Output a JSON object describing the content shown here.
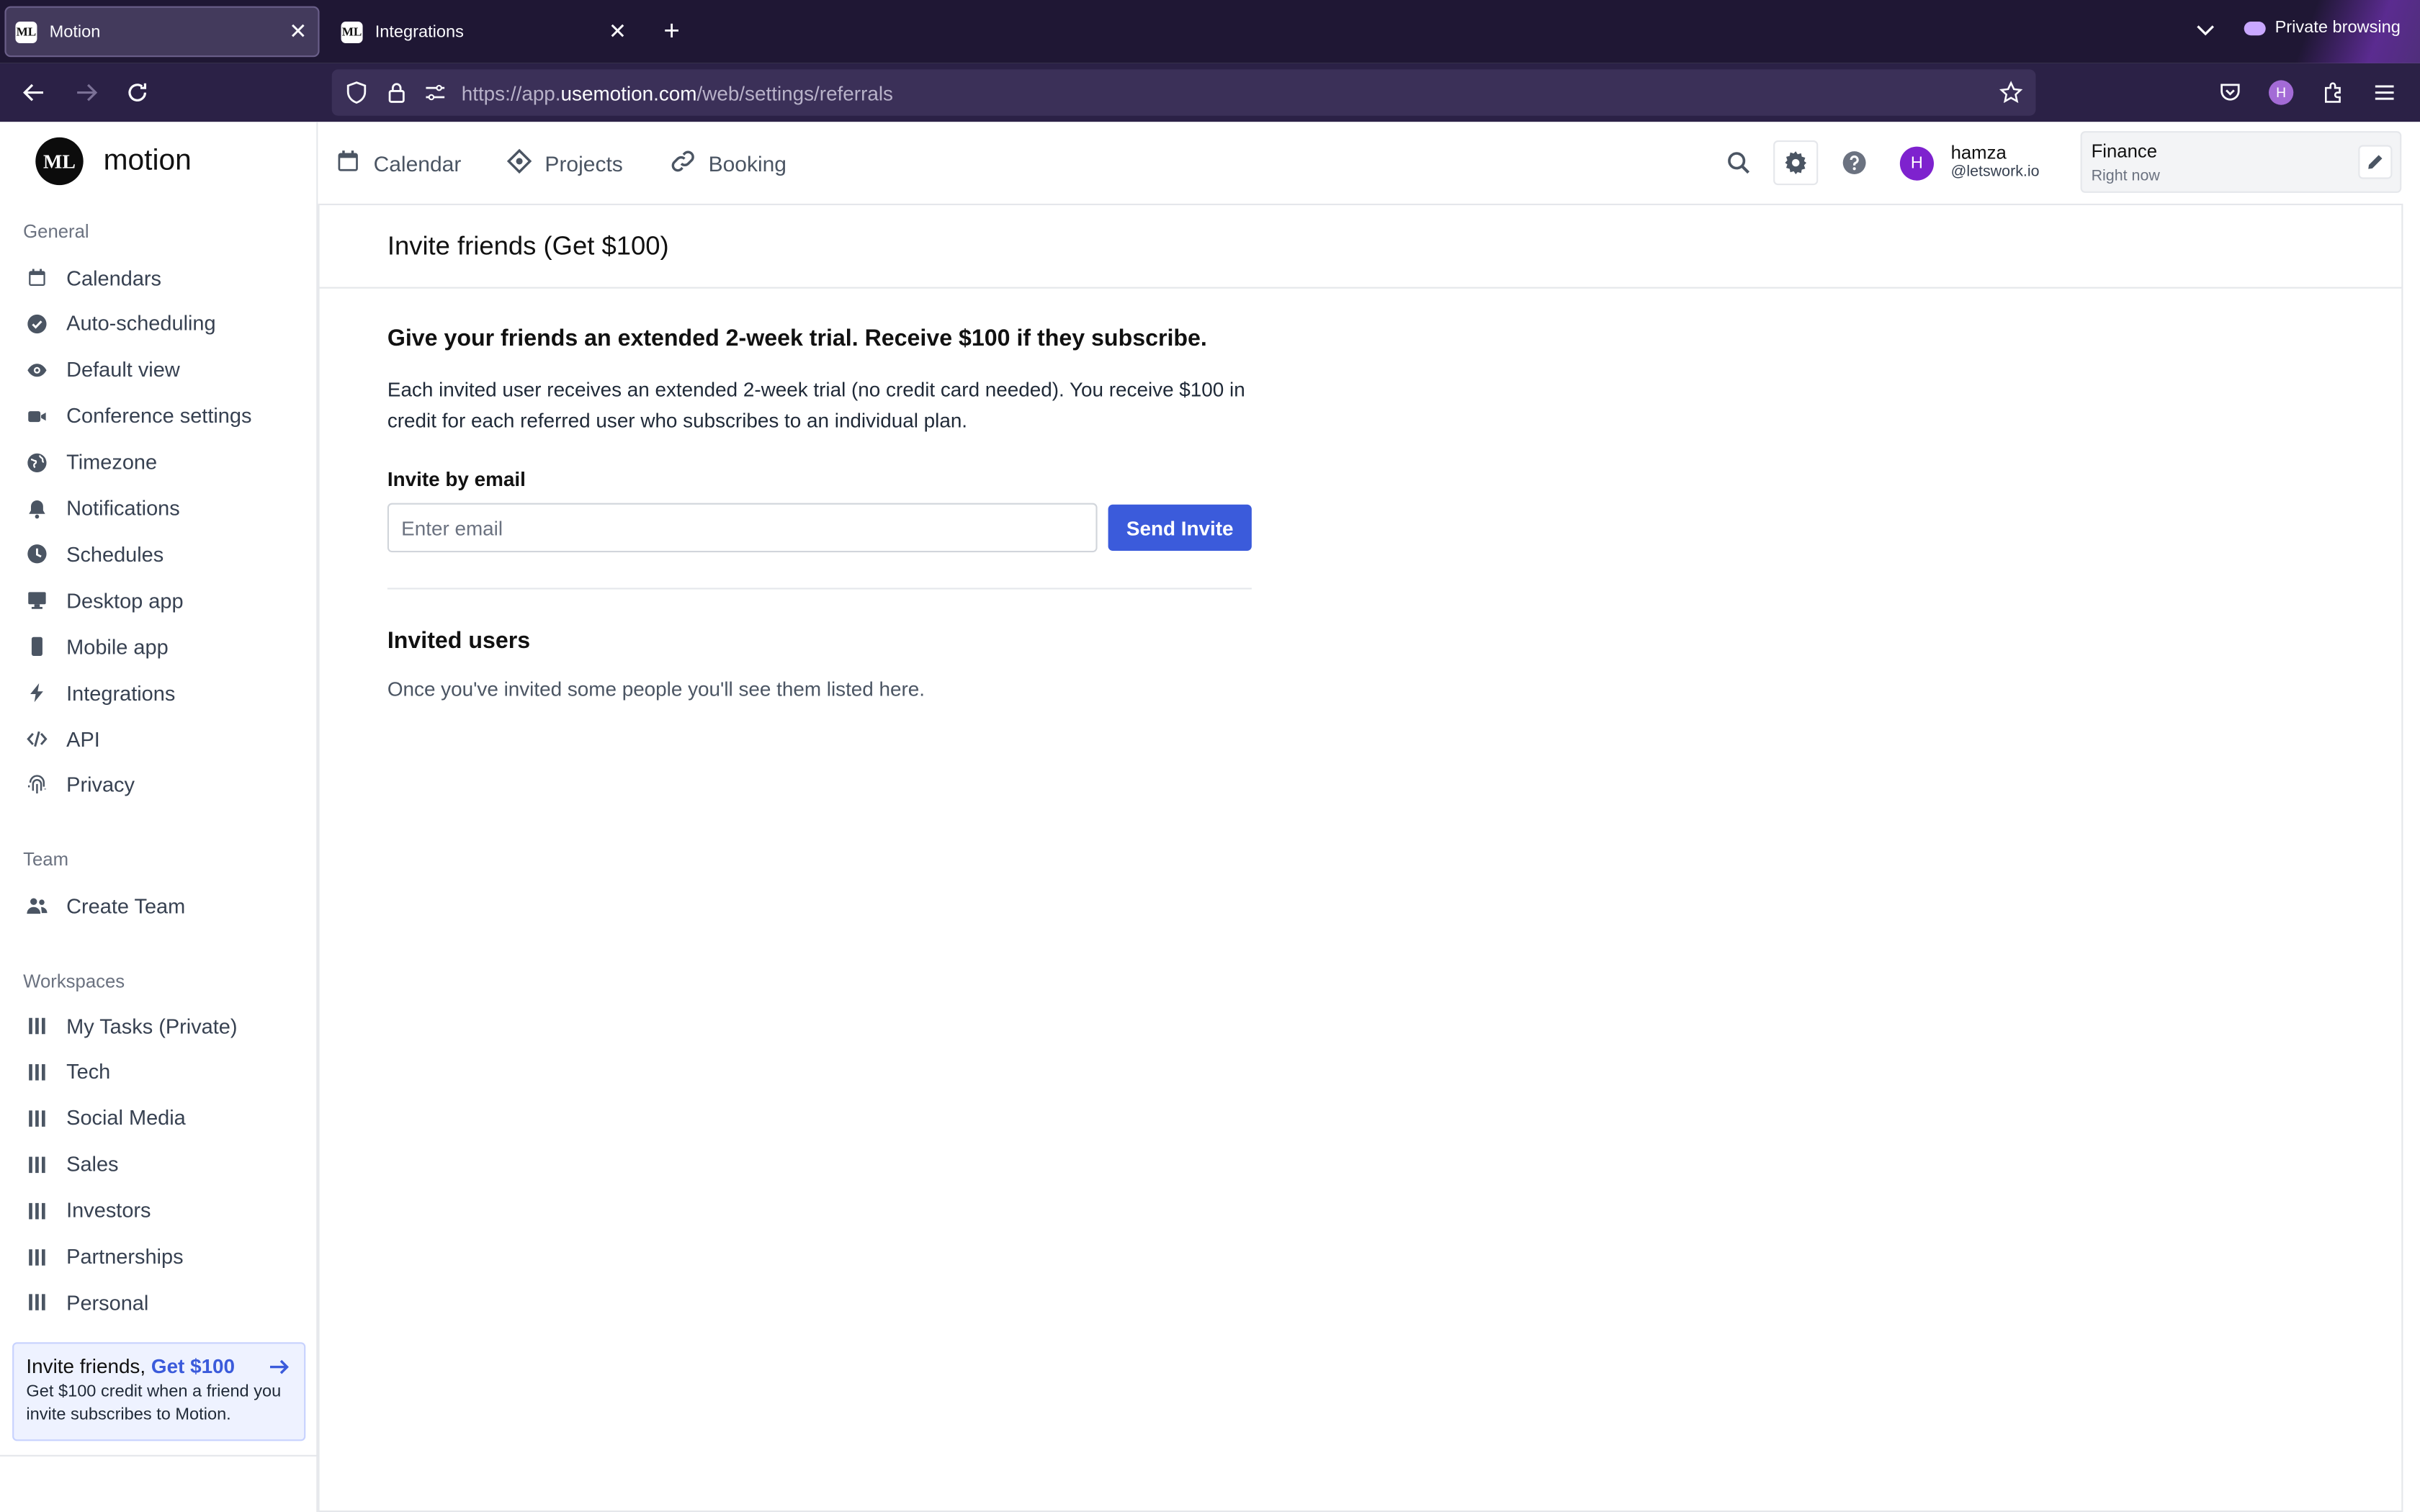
{
  "browser": {
    "tabs": [
      {
        "label": "Motion",
        "active": true
      },
      {
        "label": "Integrations",
        "active": false
      }
    ],
    "favicon_text": "ML",
    "private_label": "Private browsing",
    "url_prefix": "https://app.",
    "url_domain": "usemotion.com",
    "url_path": "/web/settings/referrals",
    "profile_initial": "H"
  },
  "app": {
    "brand": "motion",
    "logo_text": "ML",
    "nav": [
      {
        "label": "Calendar",
        "icon": "calendar-icon"
      },
      {
        "label": "Projects",
        "icon": "diamond-icon"
      },
      {
        "label": "Booking",
        "icon": "link-icon"
      }
    ],
    "user": {
      "initial": "H",
      "name": "hamza",
      "handle": "@letswork.io"
    },
    "current_task": {
      "title": "Finance",
      "subtitle": "Right now"
    }
  },
  "sidebar": {
    "general_heading": "General",
    "general": [
      {
        "label": "Calendars",
        "icon": "calendar-icon"
      },
      {
        "label": "Auto-scheduling",
        "icon": "check-circle-icon"
      },
      {
        "label": "Default view",
        "icon": "eye-icon"
      },
      {
        "label": "Conference settings",
        "icon": "video-icon"
      },
      {
        "label": "Timezone",
        "icon": "globe-icon"
      },
      {
        "label": "Notifications",
        "icon": "bell-icon"
      },
      {
        "label": "Schedules",
        "icon": "clock-icon"
      },
      {
        "label": "Desktop app",
        "icon": "desktop-icon"
      },
      {
        "label": "Mobile app",
        "icon": "mobile-icon"
      },
      {
        "label": "Integrations",
        "icon": "bolt-icon"
      },
      {
        "label": "API",
        "icon": "code-icon"
      },
      {
        "label": "Privacy",
        "icon": "fingerprint-icon"
      }
    ],
    "team_heading": "Team",
    "team": [
      {
        "label": "Create Team",
        "icon": "users-icon"
      }
    ],
    "workspaces_heading": "Workspaces",
    "workspaces": [
      {
        "label": "My Tasks (Private)",
        "icon": "columns-icon"
      },
      {
        "label": "Tech",
        "icon": "columns-icon"
      },
      {
        "label": "Social Media",
        "icon": "columns-icon"
      },
      {
        "label": "Sales",
        "icon": "columns-icon"
      },
      {
        "label": "Investors",
        "icon": "columns-icon"
      },
      {
        "label": "Partnerships",
        "icon": "columns-icon"
      },
      {
        "label": "Personal",
        "icon": "columns-icon"
      }
    ],
    "promo": {
      "title": "Invite friends,",
      "accent": "Get $100",
      "body": "Get $100 credit when a friend you invite subscribes to Motion."
    }
  },
  "page": {
    "title": "Invite friends (Get $100)",
    "headline": "Give your friends an extended 2-week trial. Receive $100 if they subscribe.",
    "description": "Each invited user receives an extended 2-week trial (no credit card needed). You receive $100 in credit for each referred user who subscribes to an individual plan.",
    "invite_label": "Invite by email",
    "email_placeholder": "Enter email",
    "email_value": "",
    "send_button": "Send Invite",
    "invited_heading": "Invited users",
    "empty_text": "Once you've invited some people you'll see them listed here."
  },
  "colors": {
    "accent": "#3b5bdb",
    "browser_tabbar": "#1f1734",
    "browser_navbar": "#2b2146",
    "avatar": "#7e22ce"
  }
}
